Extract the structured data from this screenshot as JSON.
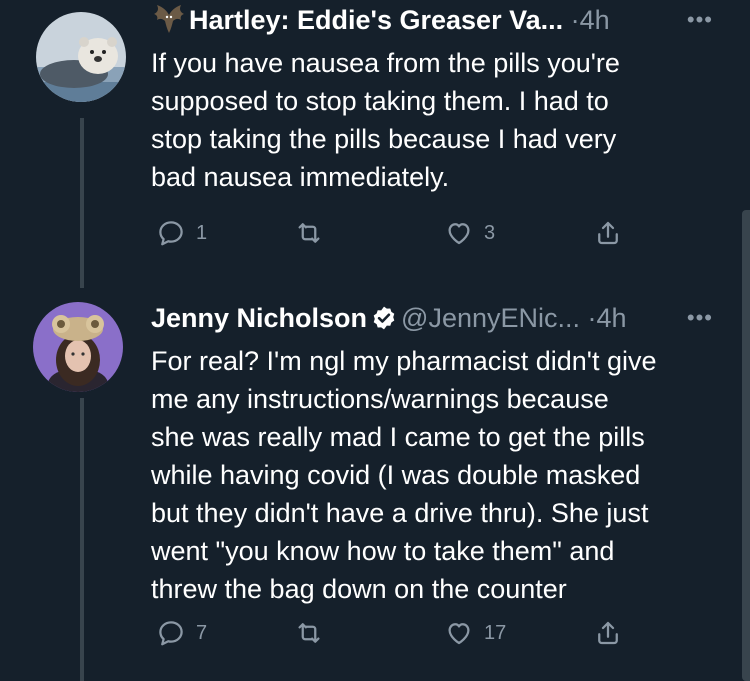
{
  "tweets": [
    {
      "author_emoji": "bat-icon",
      "author_name": "Hartley: Eddie's Greaser Va...",
      "dot": "·",
      "time": "4h",
      "more": "•••",
      "text": "If you have nausea from the pills you're\nsupposed to stop taking them. I had to\nstop taking the pills because I had very\nbad nausea immediately.",
      "replies": "1",
      "retweets": "",
      "likes": "3"
    },
    {
      "author_name": "Jenny Nicholson",
      "handle": "@JennyENic...",
      "dot": "·",
      "time": "4h",
      "more": "•••",
      "text": "For real? I'm ngl my pharmacist didn't give\nme any instructions/warnings because\nshe was really mad I came to get the pills\nwhile having covid (I was double masked\nbut they didn't have a drive thru). She just\nwent \"you know how to take them\" and\nthrew the bag down on the counter",
      "replies": "7",
      "retweets": "",
      "likes": "17"
    }
  ],
  "colors": {
    "background": "#15202b",
    "muted": "#8b98a5",
    "line": "#38444d"
  }
}
